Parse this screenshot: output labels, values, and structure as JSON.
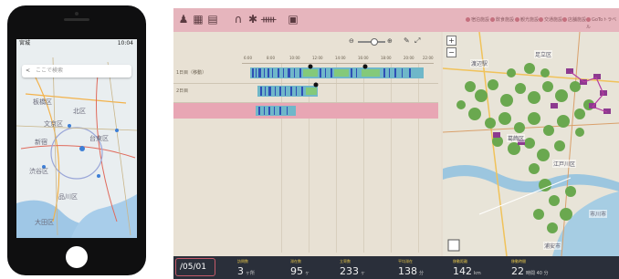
{
  "phone": {
    "status_left": "宮城",
    "status_right": "10:04",
    "search_placeholder": "ここで検索",
    "search_back_glyph": "<",
    "map_labels": [
      "板橋区",
      "北区",
      "文京区",
      "新宿",
      "台東区",
      "渋谷区",
      "品川区",
      "大田区"
    ]
  },
  "app": {
    "toolbar": {
      "icons": [
        "person-icon",
        "calendar-icon",
        "notepad-icon",
        "shape-icon",
        "settings-icon",
        "chart-icon",
        "document-icon"
      ],
      "legend": [
        "宿泊施設",
        "飲食施設",
        "観光施設",
        "交通施設",
        "店舗施設",
        "GoToトラベル",
        "地図レイヤー"
      ]
    },
    "zoom": {
      "minus": "⊖",
      "plus": "⊕"
    },
    "timeline": {
      "ruler_labels": [
        "6:00",
        "8:00",
        "10:00",
        "12:00",
        "14:00",
        "16:00",
        "18:00",
        "20:00",
        "22:00"
      ],
      "rows": [
        {
          "label": "1日目（移動）"
        },
        {
          "label": "2日目"
        },
        {
          "label": ""
        }
      ]
    },
    "map": {
      "labels": [
        "渡辺駅",
        "葛飾区",
        "江戸川区",
        "市川市",
        "足立区",
        "浦安市"
      ],
      "zoom_in": "+",
      "zoom_out": "−"
    },
    "stats": {
      "date": "/05/01",
      "items": [
        {
          "label": "訪問数",
          "value": "3",
          "unit": "ヶ所"
        },
        {
          "label": "滞在数",
          "value": "95",
          "unit": "ヶ"
        },
        {
          "label": "立寄数",
          "value": "233",
          "unit": "ヶ"
        },
        {
          "label": "平均滞在",
          "value": "138",
          "unit": "分"
        },
        {
          "label": "移動距離",
          "value": "142",
          "unit": "km"
        },
        {
          "label": "移動時間",
          "value": "22",
          "unit": "時間 40 分"
        }
      ]
    }
  }
}
